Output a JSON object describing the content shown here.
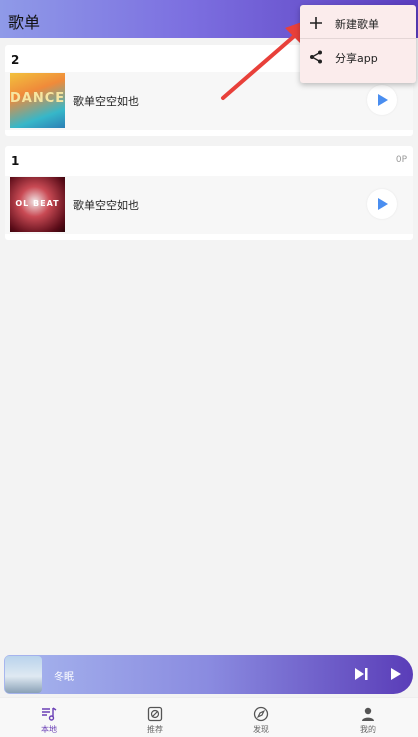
{
  "header": {
    "title": "歌单"
  },
  "playlists": [
    {
      "count": "2",
      "extra": "",
      "row_title": "歌单空空如也",
      "cover_text": "DANCE"
    },
    {
      "count": "1",
      "extra": "0P",
      "row_title": "歌单空空如也",
      "cover_text": "OL BEAT"
    }
  ],
  "menu": {
    "items": [
      {
        "label": "新建歌单",
        "icon": "plus-icon"
      },
      {
        "label": "分享app",
        "icon": "share-icon"
      }
    ]
  },
  "player": {
    "title": "冬眠"
  },
  "nav": {
    "items": [
      {
        "label": "本地",
        "icon": "music-note-icon",
        "active": true
      },
      {
        "label": "推荐",
        "icon": "recommend-icon",
        "active": false
      },
      {
        "label": "发现",
        "icon": "compass-icon",
        "active": false
      },
      {
        "label": "我的",
        "icon": "person-icon",
        "active": false
      }
    ]
  },
  "colors": {
    "accent": "#6a3fb5",
    "play_icon": "#4a8ef0",
    "arrow": "#e8403a"
  }
}
